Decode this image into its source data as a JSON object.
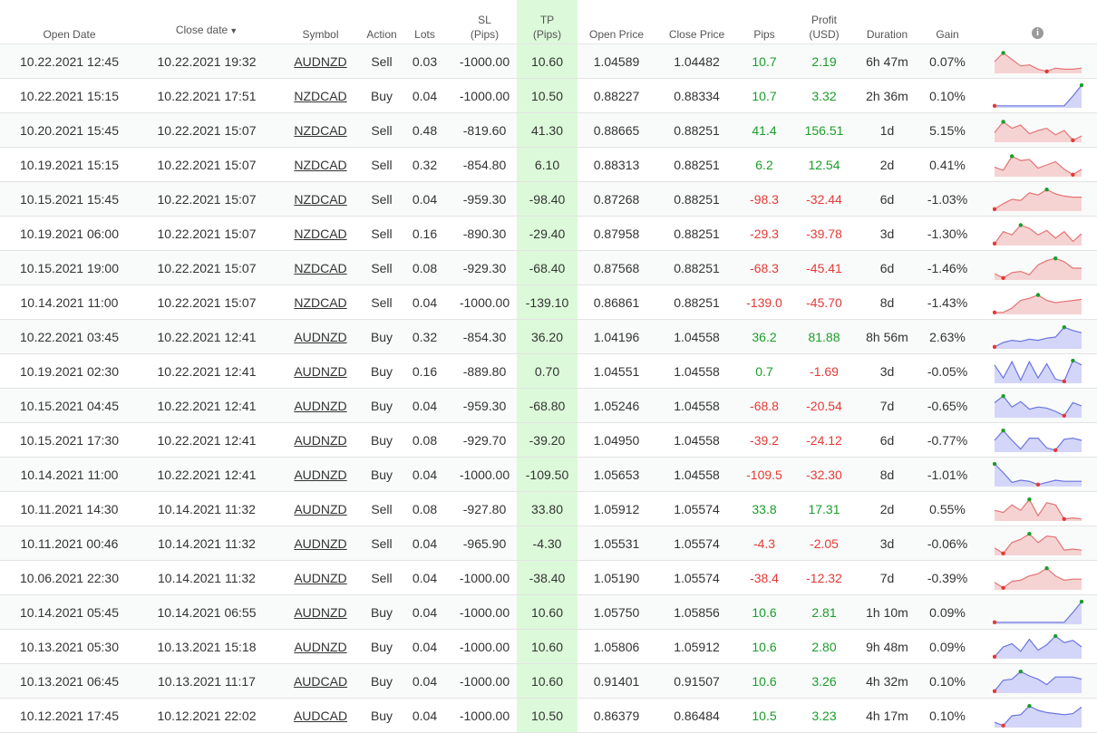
{
  "headers": {
    "open_date": "Open Date",
    "close_date": "Close date",
    "close_sort_icon": "▼",
    "symbol": "Symbol",
    "action": "Action",
    "lots": "Lots",
    "sl_1": "SL",
    "sl_2": "(Pips)",
    "tp_1": "TP",
    "tp_2": "(Pips)",
    "open_price": "Open Price",
    "close_price": "Close Price",
    "pips": "Pips",
    "profit_1": "Profit",
    "profit_2": "(USD)",
    "duration": "Duration",
    "gain": "Gain",
    "info_icon": "i"
  },
  "colors": {
    "positive": "#1a9d2a",
    "negative": "#e53935",
    "tp_highlight": "#dcfad9",
    "sell_spark_fill": "#f6d3d3",
    "sell_spark_line": "#e57373",
    "buy_spark_fill": "#d3d6f8",
    "buy_spark_line": "#6b74e0"
  },
  "trades": [
    {
      "open": "10.22.2021 12:45",
      "close": "10.22.2021 19:32",
      "symbol": "AUDNZD",
      "action": "Sell",
      "lots": "0.03",
      "sl": "-1000.00",
      "tp": "10.60",
      "open_price": "1.04589",
      "close_price": "1.04482",
      "pips": "10.7",
      "profit": "2.19",
      "duration": "6h 47m",
      "gain": "0.07%",
      "spark": [
        0.5,
        0.9,
        0.6,
        0.3,
        0.35,
        0.15,
        0.05,
        0.2,
        0.15,
        0.15,
        0.2
      ]
    },
    {
      "open": "10.22.2021 15:15",
      "close": "10.22.2021 17:51",
      "symbol": "NZDCAD",
      "action": "Buy",
      "lots": "0.04",
      "sl": "-1000.00",
      "tp": "10.50",
      "open_price": "0.88227",
      "close_price": "0.88334",
      "pips": "10.7",
      "profit": "3.32",
      "duration": "2h 36m",
      "gain": "0.10%",
      "spark": [
        0.05,
        0.05,
        0.05,
        0.05,
        0.05,
        0.05,
        0.05,
        0.05,
        0.05,
        0.5,
        1.0
      ]
    },
    {
      "open": "10.20.2021 15:45",
      "close": "10.22.2021 15:07",
      "symbol": "NZDCAD",
      "action": "Sell",
      "lots": "0.48",
      "sl": "-819.60",
      "tp": "41.30",
      "open_price": "0.88665",
      "close_price": "0.88251",
      "pips": "41.4",
      "profit": "156.51",
      "duration": "1d",
      "gain": "5.15%",
      "spark": [
        0.4,
        0.9,
        0.6,
        0.75,
        0.35,
        0.5,
        0.6,
        0.3,
        0.5,
        0.05,
        0.25
      ]
    },
    {
      "open": "10.19.2021 15:15",
      "close": "10.22.2021 15:07",
      "symbol": "NZDCAD",
      "action": "Sell",
      "lots": "0.32",
      "sl": "-854.80",
      "tp": "6.10",
      "open_price": "0.88313",
      "close_price": "0.88251",
      "pips": "6.2",
      "profit": "12.54",
      "duration": "2d",
      "gain": "0.41%",
      "spark": [
        0.4,
        0.25,
        0.9,
        0.7,
        0.75,
        0.35,
        0.5,
        0.65,
        0.3,
        0.05,
        0.3
      ]
    },
    {
      "open": "10.15.2021 15:45",
      "close": "10.22.2021 15:07",
      "symbol": "NZDCAD",
      "action": "Sell",
      "lots": "0.04",
      "sl": "-959.30",
      "tp": "-98.40",
      "open_price": "0.87268",
      "close_price": "0.88251",
      "pips": "-98.3",
      "profit": "-32.44",
      "duration": "6d",
      "gain": "-1.03%",
      "spark": [
        0.05,
        0.3,
        0.5,
        0.45,
        0.8,
        0.7,
        0.95,
        0.75,
        0.65,
        0.6,
        0.6
      ]
    },
    {
      "open": "10.19.2021 06:00",
      "close": "10.22.2021 15:07",
      "symbol": "NZDCAD",
      "action": "Sell",
      "lots": "0.16",
      "sl": "-890.30",
      "tp": "-29.40",
      "open_price": "0.87958",
      "close_price": "0.88251",
      "pips": "-29.3",
      "profit": "-39.78",
      "duration": "3d",
      "gain": "-1.30%",
      "spark": [
        0.05,
        0.6,
        0.45,
        0.9,
        0.75,
        0.45,
        0.65,
        0.3,
        0.6,
        0.15,
        0.5
      ]
    },
    {
      "open": "10.15.2021 19:00",
      "close": "10.22.2021 15:07",
      "symbol": "NZDCAD",
      "action": "Sell",
      "lots": "0.08",
      "sl": "-929.30",
      "tp": "-68.40",
      "open_price": "0.87568",
      "close_price": "0.88251",
      "pips": "-68.3",
      "profit": "-45.41",
      "duration": "6d",
      "gain": "-1.46%",
      "spark": [
        0.25,
        0.05,
        0.3,
        0.35,
        0.2,
        0.65,
        0.85,
        0.95,
        0.8,
        0.5,
        0.5
      ]
    },
    {
      "open": "10.14.2021 11:00",
      "close": "10.22.2021 15:07",
      "symbol": "NZDCAD",
      "action": "Sell",
      "lots": "0.04",
      "sl": "-1000.00",
      "tp": "-139.10",
      "open_price": "0.86861",
      "close_price": "0.88251",
      "pips": "-139.0",
      "profit": "-45.70",
      "duration": "8d",
      "gain": "-1.43%",
      "spark": [
        0.05,
        0.05,
        0.25,
        0.6,
        0.7,
        0.85,
        0.6,
        0.5,
        0.55,
        0.6,
        0.65
      ]
    },
    {
      "open": "10.22.2021 03:45",
      "close": "10.22.2021 12:41",
      "symbol": "AUDNZD",
      "action": "Buy",
      "lots": "0.32",
      "sl": "-854.30",
      "tp": "36.20",
      "open_price": "1.04196",
      "close_price": "1.04558",
      "pips": "36.2",
      "profit": "81.88",
      "duration": "8h 56m",
      "gain": "2.63%",
      "spark": [
        0.05,
        0.25,
        0.35,
        0.3,
        0.4,
        0.35,
        0.45,
        0.5,
        0.95,
        0.8,
        0.7
      ]
    },
    {
      "open": "10.19.2021 02:30",
      "close": "10.22.2021 12:41",
      "symbol": "AUDNZD",
      "action": "Buy",
      "lots": "0.16",
      "sl": "-889.80",
      "tp": "0.70",
      "open_price": "1.04551",
      "close_price": "1.04558",
      "pips": "0.7",
      "profit": "-1.69",
      "duration": "3d",
      "gain": "-0.05%",
      "spark": [
        0.8,
        0.2,
        0.95,
        0.1,
        0.95,
        0.2,
        0.85,
        0.15,
        0.05,
        1.0,
        0.8
      ]
    },
    {
      "open": "10.15.2021 04:45",
      "close": "10.22.2021 12:41",
      "symbol": "AUDNZD",
      "action": "Buy",
      "lots": "0.04",
      "sl": "-959.30",
      "tp": "-68.80",
      "open_price": "1.05246",
      "close_price": "1.04558",
      "pips": "-68.8",
      "profit": "-20.54",
      "duration": "7d",
      "gain": "-0.65%",
      "spark": [
        0.65,
        0.95,
        0.45,
        0.7,
        0.35,
        0.45,
        0.4,
        0.25,
        0.05,
        0.65,
        0.5
      ]
    },
    {
      "open": "10.15.2021 17:30",
      "close": "10.22.2021 12:41",
      "symbol": "AUDNZD",
      "action": "Buy",
      "lots": "0.08",
      "sl": "-929.70",
      "tp": "-39.20",
      "open_price": "1.04950",
      "close_price": "1.04558",
      "pips": "-39.2",
      "profit": "-24.12",
      "duration": "6d",
      "gain": "-0.77%",
      "spark": [
        0.5,
        0.95,
        0.5,
        0.1,
        0.6,
        0.6,
        0.15,
        0.05,
        0.55,
        0.6,
        0.5
      ]
    },
    {
      "open": "10.14.2021 11:00",
      "close": "10.22.2021 12:41",
      "symbol": "AUDNZD",
      "action": "Buy",
      "lots": "0.04",
      "sl": "-1000.00",
      "tp": "-109.50",
      "open_price": "1.05653",
      "close_price": "1.04558",
      "pips": "-109.5",
      "profit": "-32.30",
      "duration": "8d",
      "gain": "-1.01%",
      "spark": [
        1.0,
        0.6,
        0.15,
        0.25,
        0.2,
        0.05,
        0.15,
        0.25,
        0.2,
        0.2,
        0.2
      ]
    },
    {
      "open": "10.11.2021 14:30",
      "close": "10.14.2021 11:32",
      "symbol": "AUDNZD",
      "action": "Sell",
      "lots": "0.08",
      "sl": "-927.80",
      "tp": "33.80",
      "open_price": "1.05912",
      "close_price": "1.05574",
      "pips": "33.8",
      "profit": "17.31",
      "duration": "2d",
      "gain": "0.55%",
      "spark": [
        0.45,
        0.35,
        0.7,
        0.45,
        0.95,
        0.2,
        0.8,
        0.7,
        0.05,
        0.1,
        0.05
      ]
    },
    {
      "open": "10.11.2021 00:46",
      "close": "10.14.2021 11:32",
      "symbol": "AUDNZD",
      "action": "Sell",
      "lots": "0.04",
      "sl": "-965.90",
      "tp": "-4.30",
      "open_price": "1.05531",
      "close_price": "1.05574",
      "pips": "-4.3",
      "profit": "-2.05",
      "duration": "3d",
      "gain": "-0.06%",
      "spark": [
        0.3,
        0.05,
        0.55,
        0.7,
        0.95,
        0.55,
        0.85,
        0.8,
        0.2,
        0.25,
        0.2
      ]
    },
    {
      "open": "10.06.2021 22:30",
      "close": "10.14.2021 11:32",
      "symbol": "AUDNZD",
      "action": "Sell",
      "lots": "0.04",
      "sl": "-1000.00",
      "tp": "-38.40",
      "open_price": "1.05190",
      "close_price": "1.05574",
      "pips": "-38.4",
      "profit": "-12.32",
      "duration": "7d",
      "gain": "-0.39%",
      "spark": [
        0.3,
        0.05,
        0.35,
        0.4,
        0.6,
        0.7,
        0.95,
        0.6,
        0.4,
        0.45,
        0.45
      ]
    },
    {
      "open": "10.14.2021 05:45",
      "close": "10.14.2021 06:55",
      "symbol": "AUDNZD",
      "action": "Buy",
      "lots": "0.04",
      "sl": "-1000.00",
      "tp": "10.60",
      "open_price": "1.05750",
      "close_price": "1.05856",
      "pips": "10.6",
      "profit": "2.81",
      "duration": "1h 10m",
      "gain": "0.09%",
      "spark": [
        0.05,
        0.05,
        0.05,
        0.05,
        0.05,
        0.05,
        0.05,
        0.05,
        0.05,
        0.5,
        1.0
      ]
    },
    {
      "open": "10.13.2021 05:30",
      "close": "10.13.2021 15:18",
      "symbol": "AUDNZD",
      "action": "Buy",
      "lots": "0.04",
      "sl": "-1000.00",
      "tp": "10.60",
      "open_price": "1.05806",
      "close_price": "1.05912",
      "pips": "10.6",
      "profit": "2.80",
      "duration": "9h 48m",
      "gain": "0.09%",
      "spark": [
        0.05,
        0.5,
        0.65,
        0.3,
        0.85,
        0.35,
        0.6,
        1.0,
        0.7,
        0.8,
        0.5
      ]
    },
    {
      "open": "10.13.2021 06:45",
      "close": "10.13.2021 11:17",
      "symbol": "AUDCAD",
      "action": "Buy",
      "lots": "0.04",
      "sl": "-1000.00",
      "tp": "10.60",
      "open_price": "0.91401",
      "close_price": "0.91507",
      "pips": "10.6",
      "profit": "3.26",
      "duration": "4h 32m",
      "gain": "0.10%",
      "spark": [
        0.05,
        0.55,
        0.6,
        0.95,
        0.75,
        0.6,
        0.35,
        0.7,
        0.7,
        0.7,
        0.6
      ]
    },
    {
      "open": "10.12.2021 17:45",
      "close": "10.12.2021 22:02",
      "symbol": "AUDCAD",
      "action": "Buy",
      "lots": "0.04",
      "sl": "-1000.00",
      "tp": "10.50",
      "open_price": "0.86379",
      "close_price": "0.86484",
      "pips": "10.5",
      "profit": "3.23",
      "duration": "4h 17m",
      "gain": "0.10%",
      "spark": [
        0.2,
        0.05,
        0.5,
        0.55,
        0.95,
        0.75,
        0.65,
        0.6,
        0.55,
        0.6,
        0.9
      ]
    }
  ]
}
